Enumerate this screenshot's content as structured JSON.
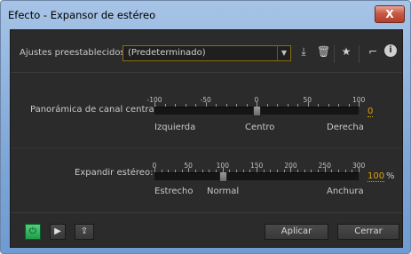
{
  "window": {
    "title": "Efecto - Expansor de estéreo",
    "close_glyph": "X"
  },
  "presets": {
    "label": "Ajustes preestablecidos:",
    "value": "(Predeterminado)",
    "icons": [
      "save-preset-icon",
      "delete-preset-icon",
      "favorite-star-icon",
      "routing-icon",
      "info-icon"
    ]
  },
  "pan": {
    "label": "Panorámica de canal central:",
    "scale": [
      "-100",
      "-50",
      "0",
      "50",
      "100"
    ],
    "left_label": "Izquierda",
    "center_label": "Centro",
    "right_label": "Derecha",
    "value": "0",
    "level": 0
  },
  "width": {
    "label": "Expandir estéreo:",
    "scale": [
      "0",
      "50",
      "100",
      "150",
      "200",
      "250",
      "300"
    ],
    "left_label": "Estrecho",
    "center_label": "Normal",
    "right_label": "Anchura",
    "value": "100",
    "unit": "%",
    "level": 100
  },
  "footer": {
    "apply_label": "Aplicar",
    "close_label": "Cerrar"
  },
  "colors": {
    "accent": "#e0a000",
    "power_on": "#2fb35c"
  }
}
